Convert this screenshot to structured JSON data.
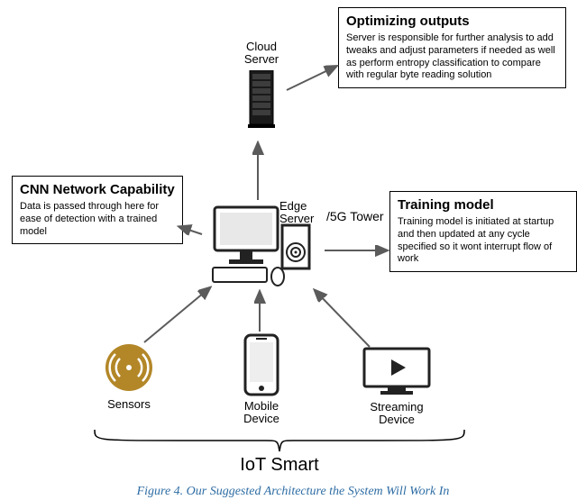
{
  "caption": "Figure 4. Our Suggested Architecture the System Will Work In",
  "nodes": {
    "cloud_server": {
      "label": "Cloud\nServer"
    },
    "edge_server": {
      "label": "Edge\nServer"
    },
    "edge_annot": "/5G Tower",
    "sensors": {
      "label": "Sensors"
    },
    "mobile": {
      "label": "Mobile\nDevice"
    },
    "streaming": {
      "label": "Streaming\nDevice"
    },
    "iot_group": "IoT Smart"
  },
  "callouts": {
    "optimizing": {
      "title": "Optimizing outputs",
      "body": "Server is responsible for further analysis to add tweaks and adjust parameters if needed as well as perform entropy classification to compare with regular byte reading solution"
    },
    "cnn": {
      "title": "CNN Network Capability",
      "body": "Data is passed through here for ease of detection with a trained model"
    },
    "training": {
      "title": "Training model",
      "body": "Training model is initiated at startup and then updated at any cycle specified so it wont interrupt flow of work"
    }
  }
}
